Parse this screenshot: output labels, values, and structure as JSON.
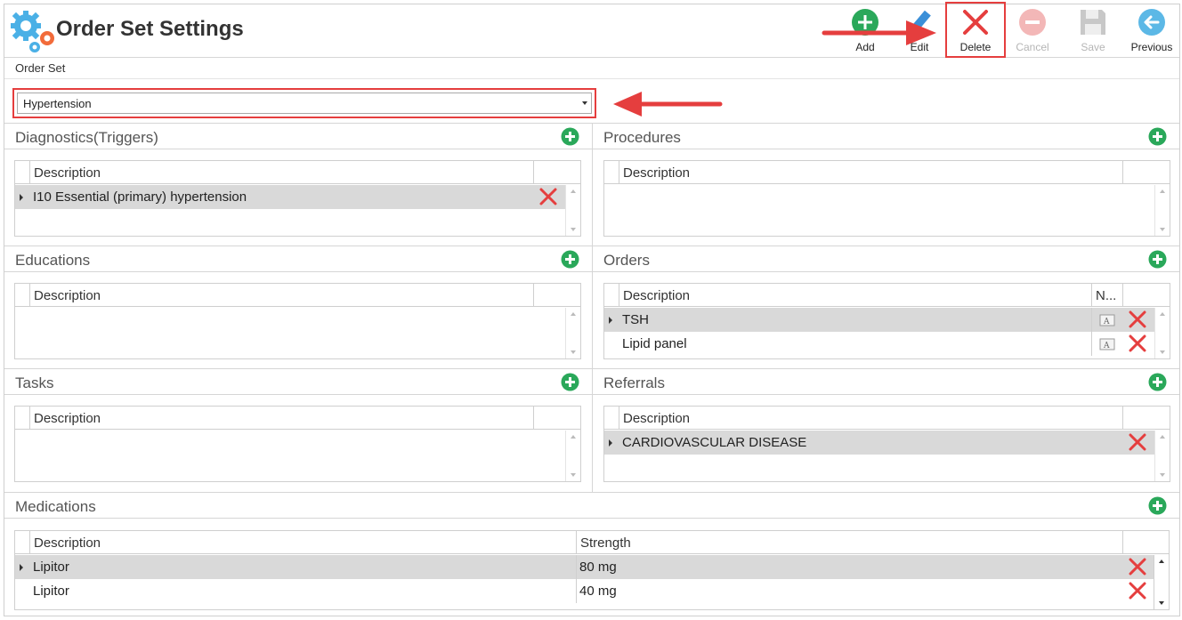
{
  "app": {
    "title": "Order Set Settings"
  },
  "toolbar": {
    "add": "Add",
    "edit": "Edit",
    "delete": "Delete",
    "cancel": "Cancel",
    "save": "Save",
    "previous": "Previous"
  },
  "order_set": {
    "label": "Order Set",
    "selected": "Hypertension"
  },
  "sections": {
    "diagnostics": {
      "title": "Diagnostics(Triggers)",
      "col_description": "Description",
      "rows": [
        {
          "description": "I10 Essential (primary) hypertension"
        }
      ]
    },
    "procedures": {
      "title": "Procedures",
      "col_description": "Description",
      "rows": []
    },
    "educations": {
      "title": "Educations",
      "col_description": "Description",
      "rows": []
    },
    "orders": {
      "title": "Orders",
      "col_description": "Description",
      "col_note": "N...",
      "rows": [
        {
          "description": "TSH"
        },
        {
          "description": "Lipid panel"
        }
      ]
    },
    "tasks": {
      "title": "Tasks",
      "col_description": "Description",
      "rows": []
    },
    "referrals": {
      "title": "Referrals",
      "col_description": "Description",
      "rows": [
        {
          "description": "CARDIOVASCULAR DISEASE"
        }
      ]
    },
    "medications": {
      "title": "Medications",
      "col_description": "Description",
      "col_strength": "Strength",
      "rows": [
        {
          "description": "Lipitor",
          "strength": "80 mg"
        },
        {
          "description": "Lipitor",
          "strength": "40 mg"
        }
      ]
    }
  },
  "colors": {
    "accent_red": "#e53e3e",
    "add_green": "#2aa85a",
    "selected_row": "#d9d9d9"
  }
}
